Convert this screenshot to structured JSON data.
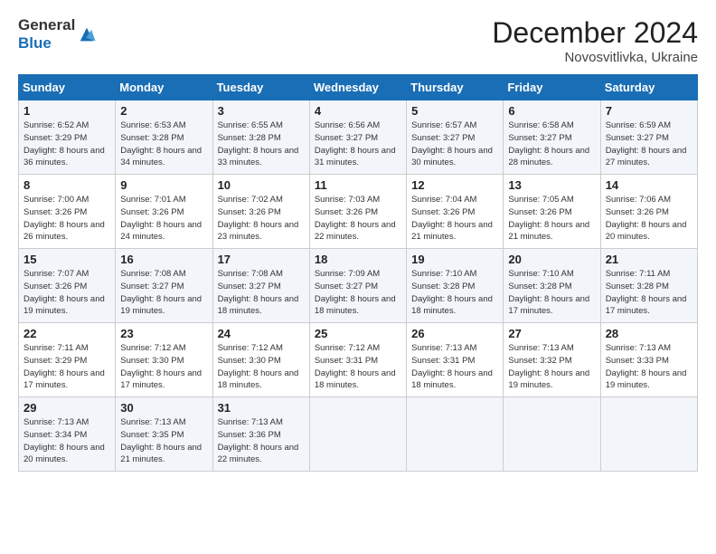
{
  "header": {
    "logo_line1": "General",
    "logo_line2": "Blue",
    "month": "December 2024",
    "location": "Novosvitlivka, Ukraine"
  },
  "days_of_week": [
    "Sunday",
    "Monday",
    "Tuesday",
    "Wednesday",
    "Thursday",
    "Friday",
    "Saturday"
  ],
  "weeks": [
    [
      {
        "day": 1,
        "sunrise": "6:52 AM",
        "sunset": "3:29 PM",
        "daylight": "8 hours and 36 minutes."
      },
      {
        "day": 2,
        "sunrise": "6:53 AM",
        "sunset": "3:28 PM",
        "daylight": "8 hours and 34 minutes."
      },
      {
        "day": 3,
        "sunrise": "6:55 AM",
        "sunset": "3:28 PM",
        "daylight": "8 hours and 33 minutes."
      },
      {
        "day": 4,
        "sunrise": "6:56 AM",
        "sunset": "3:27 PM",
        "daylight": "8 hours and 31 minutes."
      },
      {
        "day": 5,
        "sunrise": "6:57 AM",
        "sunset": "3:27 PM",
        "daylight": "8 hours and 30 minutes."
      },
      {
        "day": 6,
        "sunrise": "6:58 AM",
        "sunset": "3:27 PM",
        "daylight": "8 hours and 28 minutes."
      },
      {
        "day": 7,
        "sunrise": "6:59 AM",
        "sunset": "3:27 PM",
        "daylight": "8 hours and 27 minutes."
      }
    ],
    [
      {
        "day": 8,
        "sunrise": "7:00 AM",
        "sunset": "3:26 PM",
        "daylight": "8 hours and 26 minutes."
      },
      {
        "day": 9,
        "sunrise": "7:01 AM",
        "sunset": "3:26 PM",
        "daylight": "8 hours and 24 minutes."
      },
      {
        "day": 10,
        "sunrise": "7:02 AM",
        "sunset": "3:26 PM",
        "daylight": "8 hours and 23 minutes."
      },
      {
        "day": 11,
        "sunrise": "7:03 AM",
        "sunset": "3:26 PM",
        "daylight": "8 hours and 22 minutes."
      },
      {
        "day": 12,
        "sunrise": "7:04 AM",
        "sunset": "3:26 PM",
        "daylight": "8 hours and 21 minutes."
      },
      {
        "day": 13,
        "sunrise": "7:05 AM",
        "sunset": "3:26 PM",
        "daylight": "8 hours and 21 minutes."
      },
      {
        "day": 14,
        "sunrise": "7:06 AM",
        "sunset": "3:26 PM",
        "daylight": "8 hours and 20 minutes."
      }
    ],
    [
      {
        "day": 15,
        "sunrise": "7:07 AM",
        "sunset": "3:26 PM",
        "daylight": "8 hours and 19 minutes."
      },
      {
        "day": 16,
        "sunrise": "7:08 AM",
        "sunset": "3:27 PM",
        "daylight": "8 hours and 19 minutes."
      },
      {
        "day": 17,
        "sunrise": "7:08 AM",
        "sunset": "3:27 PM",
        "daylight": "8 hours and 18 minutes."
      },
      {
        "day": 18,
        "sunrise": "7:09 AM",
        "sunset": "3:27 PM",
        "daylight": "8 hours and 18 minutes."
      },
      {
        "day": 19,
        "sunrise": "7:10 AM",
        "sunset": "3:28 PM",
        "daylight": "8 hours and 18 minutes."
      },
      {
        "day": 20,
        "sunrise": "7:10 AM",
        "sunset": "3:28 PM",
        "daylight": "8 hours and 17 minutes."
      },
      {
        "day": 21,
        "sunrise": "7:11 AM",
        "sunset": "3:28 PM",
        "daylight": "8 hours and 17 minutes."
      }
    ],
    [
      {
        "day": 22,
        "sunrise": "7:11 AM",
        "sunset": "3:29 PM",
        "daylight": "8 hours and 17 minutes."
      },
      {
        "day": 23,
        "sunrise": "7:12 AM",
        "sunset": "3:30 PM",
        "daylight": "8 hours and 17 minutes."
      },
      {
        "day": 24,
        "sunrise": "7:12 AM",
        "sunset": "3:30 PM",
        "daylight": "8 hours and 18 minutes."
      },
      {
        "day": 25,
        "sunrise": "7:12 AM",
        "sunset": "3:31 PM",
        "daylight": "8 hours and 18 minutes."
      },
      {
        "day": 26,
        "sunrise": "7:13 AM",
        "sunset": "3:31 PM",
        "daylight": "8 hours and 18 minutes."
      },
      {
        "day": 27,
        "sunrise": "7:13 AM",
        "sunset": "3:32 PM",
        "daylight": "8 hours and 19 minutes."
      },
      {
        "day": 28,
        "sunrise": "7:13 AM",
        "sunset": "3:33 PM",
        "daylight": "8 hours and 19 minutes."
      }
    ],
    [
      {
        "day": 29,
        "sunrise": "7:13 AM",
        "sunset": "3:34 PM",
        "daylight": "8 hours and 20 minutes."
      },
      {
        "day": 30,
        "sunrise": "7:13 AM",
        "sunset": "3:35 PM",
        "daylight": "8 hours and 21 minutes."
      },
      {
        "day": 31,
        "sunrise": "7:13 AM",
        "sunset": "3:36 PM",
        "daylight": "8 hours and 22 minutes."
      },
      null,
      null,
      null,
      null
    ]
  ],
  "labels": {
    "sunrise": "Sunrise:",
    "sunset": "Sunset:",
    "daylight": "Daylight:"
  }
}
